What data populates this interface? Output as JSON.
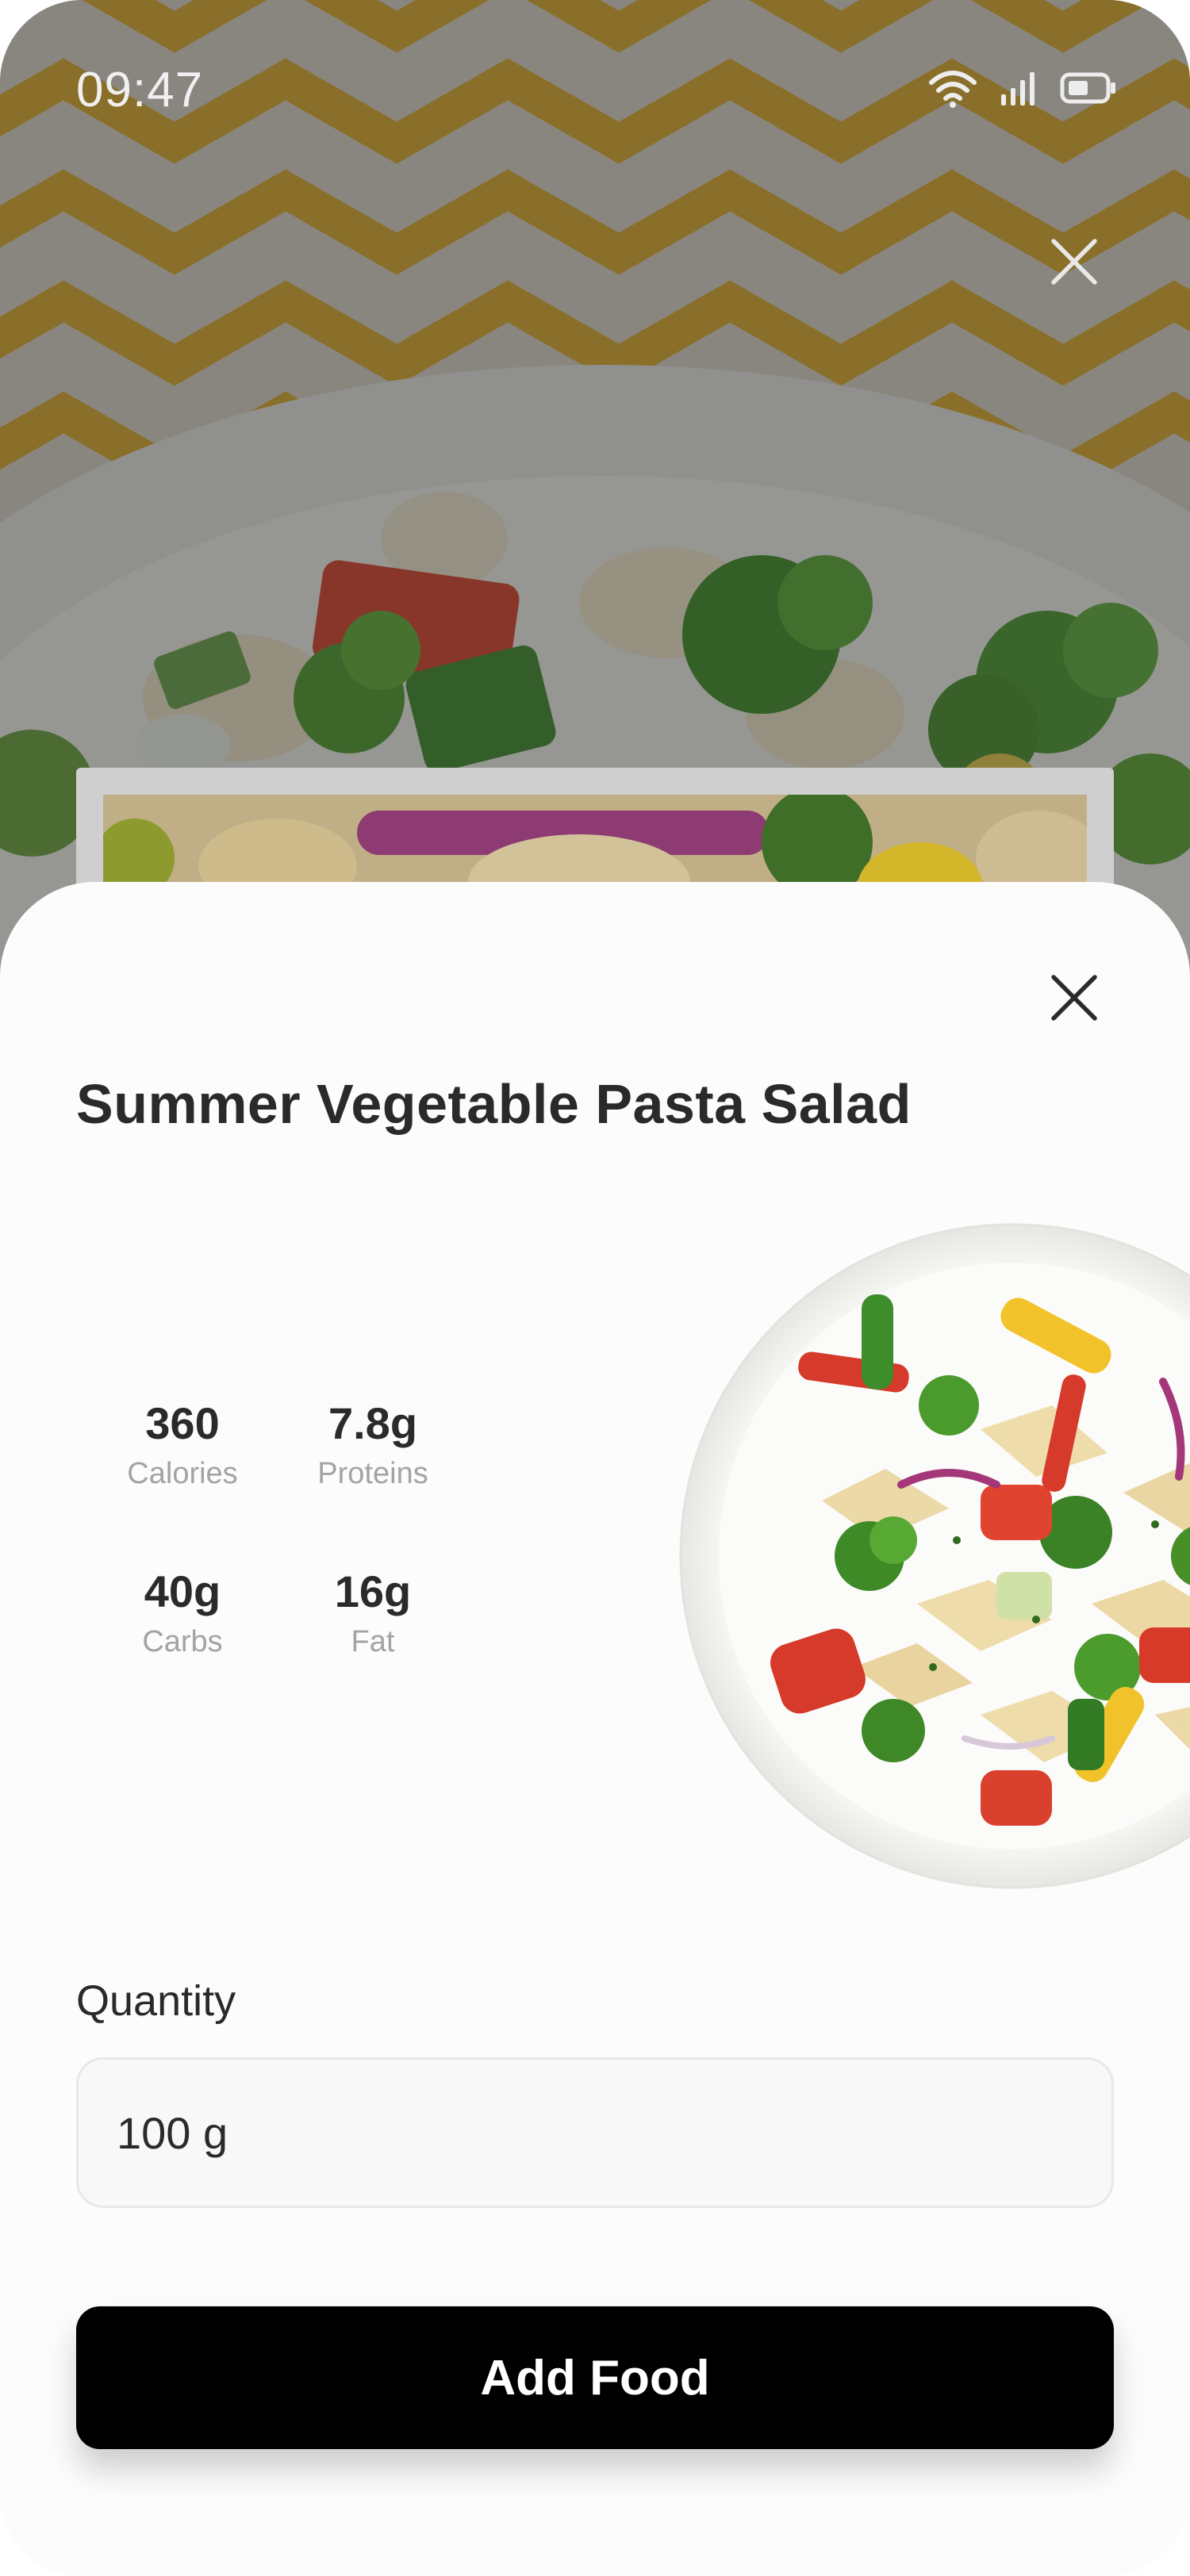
{
  "status_bar": {
    "time": "09:47",
    "icons": [
      "wifi-icon",
      "cellular-signal-icon",
      "battery-icon"
    ]
  },
  "header": {
    "close_icon": "close-icon"
  },
  "sheet": {
    "close_icon": "close-icon",
    "title": "Summer Vegetable Pasta Salad",
    "nutrition": [
      {
        "value": "360",
        "label": "Calories"
      },
      {
        "value": "7.8g",
        "label": "Proteins"
      },
      {
        "value": "40g",
        "label": "Carbs"
      },
      {
        "value": "16g",
        "label": "Fat"
      }
    ],
    "quantity": {
      "label": "Quantity",
      "value": "100 g"
    },
    "add_button_label": "Add Food"
  },
  "colors": {
    "text_primary": "#2a2a2a",
    "text_secondary": "#a3a3a3",
    "button_bg": "#000000",
    "button_text": "#ffffff",
    "sheet_bg": "#fcfcfc"
  }
}
